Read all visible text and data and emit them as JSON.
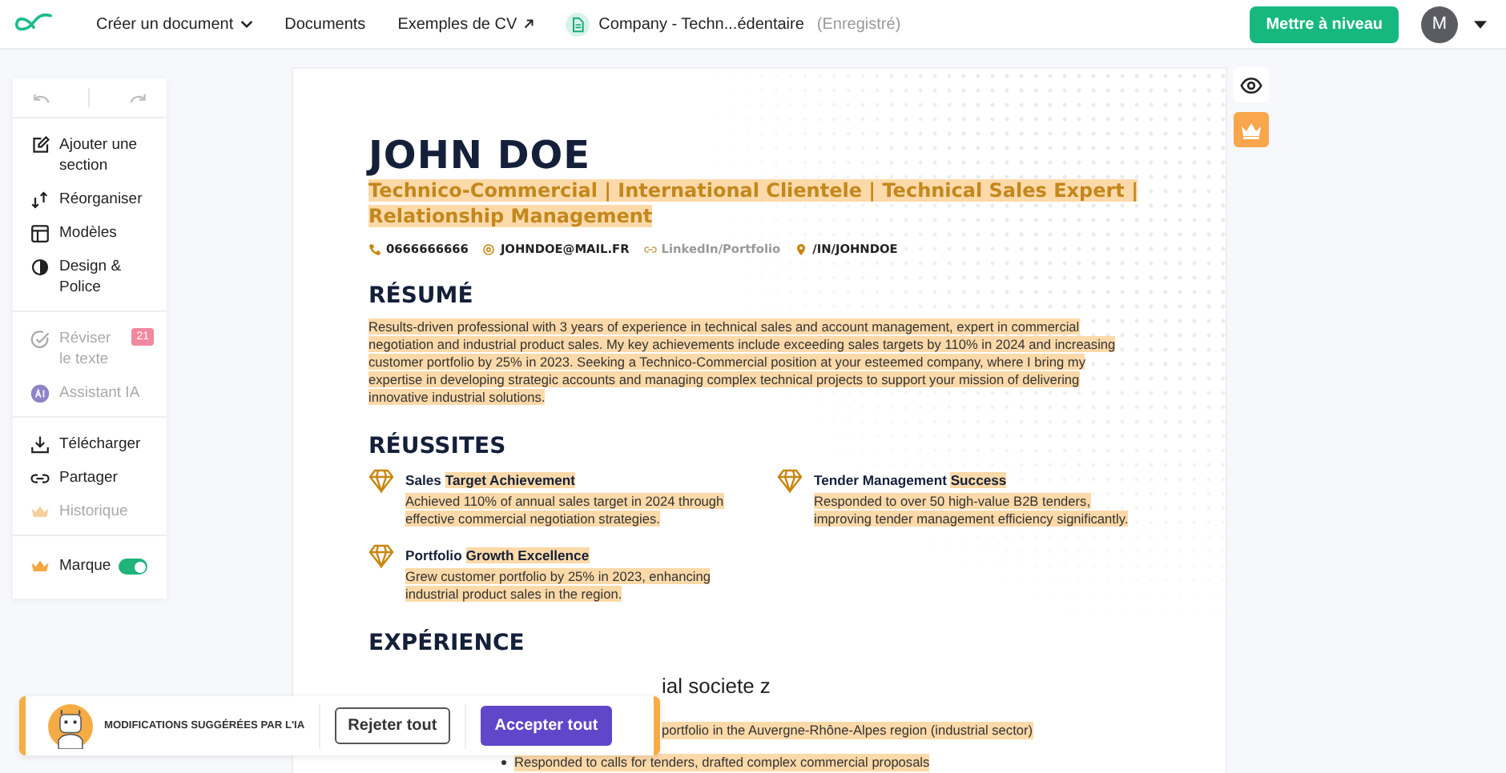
{
  "topbar": {
    "nav": [
      {
        "label": "Créer un document",
        "kind": "dropdown"
      },
      {
        "label": "Documents",
        "kind": "plain"
      },
      {
        "label": "Exemples de CV",
        "kind": "external"
      }
    ],
    "document": {
      "title": "Company - Techn...édentaire",
      "status": "(Enregistré)"
    },
    "upgrade": "Mettre à niveau",
    "avatar": "M"
  },
  "sidebar": {
    "groups": [
      [
        {
          "label": "Ajouter une section",
          "disabled": false
        },
        {
          "label": "Réorganiser",
          "disabled": false
        },
        {
          "label": "Modèles",
          "disabled": false
        },
        {
          "label": "Design & Police",
          "disabled": false
        }
      ],
      [
        {
          "label": "Réviser le texte",
          "disabled": true,
          "badge": "21"
        },
        {
          "label": "Assistant IA",
          "disabled": true
        }
      ],
      [
        {
          "label": "Télécharger",
          "disabled": false
        },
        {
          "label": "Partager",
          "disabled": false
        },
        {
          "label": "Historique",
          "disabled": true
        }
      ],
      [
        {
          "label": "Marque",
          "disabled": false,
          "toggle": true
        }
      ]
    ]
  },
  "resume": {
    "name": "JOHN DOE",
    "headline": "Technico-Commercial | International Clientele | Technical Sales Expert | Relationship Management",
    "contacts": [
      {
        "text": "0666666666",
        "muted": false
      },
      {
        "text": "JOHNDOE@MAIL.FR",
        "muted": false
      },
      {
        "text": "LinkedIn/Portfolio",
        "muted": true
      },
      {
        "text": "/IN/JOHNDOE",
        "muted": false
      }
    ],
    "summary_heading": "RÉSUMÉ",
    "summary": "Results-driven professional with 3 years of experience in technical sales and account management, expert in commercial negotiation and industrial product sales. My key achievements include exceeding sales targets by 110% in 2024 and increasing customer portfolio by 25% in 2023. Seeking a Technico-Commercial position at your esteemed company, where I bring my expertise in developing strategic accounts and managing complex technical projects to support your mission of delivering innovative industrial solutions.",
    "achievements_heading": "RÉUSSITES",
    "achievements": [
      {
        "title": "Sales **Target Achievement**",
        "text": "Achieved 110% of annual sales target in 2024 through effective commercial negotiation strategies."
      },
      {
        "title": "Tender Management **Success**",
        "text": "Responded to over 50 high-value B2B tenders, improving tender management efficiency significantly."
      },
      {
        "title": "Portfolio **Growth Excellence**",
        "text": "Grew customer portfolio by 25% in 2023, enhancing industrial product sales in the region."
      }
    ],
    "experience_heading": "EXPÉRIENCE",
    "experience_title": "ial societe z",
    "experience_bullets": [
      "portfolio in the Auvergne-Rhône-Alpes region (industrial sector)",
      "Responded to calls for tenders, drafted complex commercial proposals"
    ]
  },
  "ai_banner": {
    "label": "MODIFICATIONS SUGGÉRÉES PAR L'IA",
    "reject": "Rejeter tout",
    "accept": "Accepter tout"
  }
}
